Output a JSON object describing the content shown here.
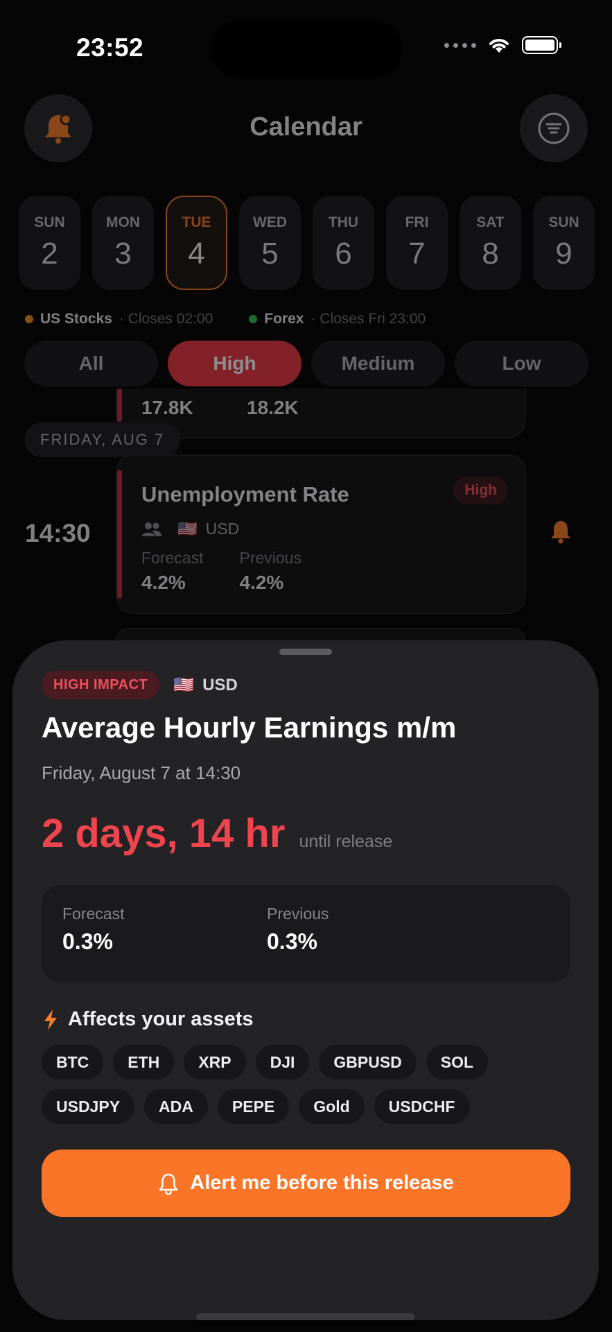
{
  "status_bar": {
    "time": "23:52"
  },
  "header": {
    "title": "Calendar"
  },
  "days": [
    {
      "name": "SUN",
      "num": "2"
    },
    {
      "name": "MON",
      "num": "3"
    },
    {
      "name": "TUE",
      "num": "4",
      "selected": true
    },
    {
      "name": "WED",
      "num": "5"
    },
    {
      "name": "THU",
      "num": "6"
    },
    {
      "name": "FRI",
      "num": "7"
    },
    {
      "name": "SAT",
      "num": "8"
    },
    {
      "name": "SUN",
      "num": "9"
    }
  ],
  "markets": [
    {
      "name": "US Stocks",
      "closes": "· Closes 02:00",
      "color": "#f0902a"
    },
    {
      "name": "Forex",
      "closes": "· Closes Fri 23:00",
      "color": "#2fbf5a"
    }
  ],
  "filters": [
    "All",
    "High",
    "Medium",
    "Low"
  ],
  "partial_card": {
    "forecast": "17.8K",
    "previous": "18.2K"
  },
  "date_header": "FRIDAY, AUG 7",
  "event": {
    "time": "14:30",
    "title": "Unemployment Rate",
    "impact": "High",
    "flag": "🇺🇸",
    "currency": "USD",
    "forecast_label": "Forecast",
    "forecast": "4.2%",
    "previous_label": "Previous",
    "previous": "4.2%"
  },
  "sheet": {
    "impact_label": "HIGH IMPACT",
    "flag": "🇺🇸",
    "currency": "USD",
    "title": "Average Hourly Earnings m/m",
    "subtitle": "Friday, August 7 at 14:30",
    "countdown": "2 days, 14 hr",
    "countdown_suffix": "until release",
    "forecast_label": "Forecast",
    "forecast": "0.3%",
    "previous_label": "Previous",
    "previous": "0.3%",
    "affects_title": "Affects your assets",
    "assets": [
      "BTC",
      "ETH",
      "XRP",
      "DJI",
      "GBPUSD",
      "SOL",
      "USDJPY",
      "ADA",
      "PEPE",
      "Gold",
      "USDCHF"
    ],
    "alert_button": "Alert me before this release"
  },
  "colors": {
    "accent": "#fb7529",
    "high": "#f0444e"
  }
}
